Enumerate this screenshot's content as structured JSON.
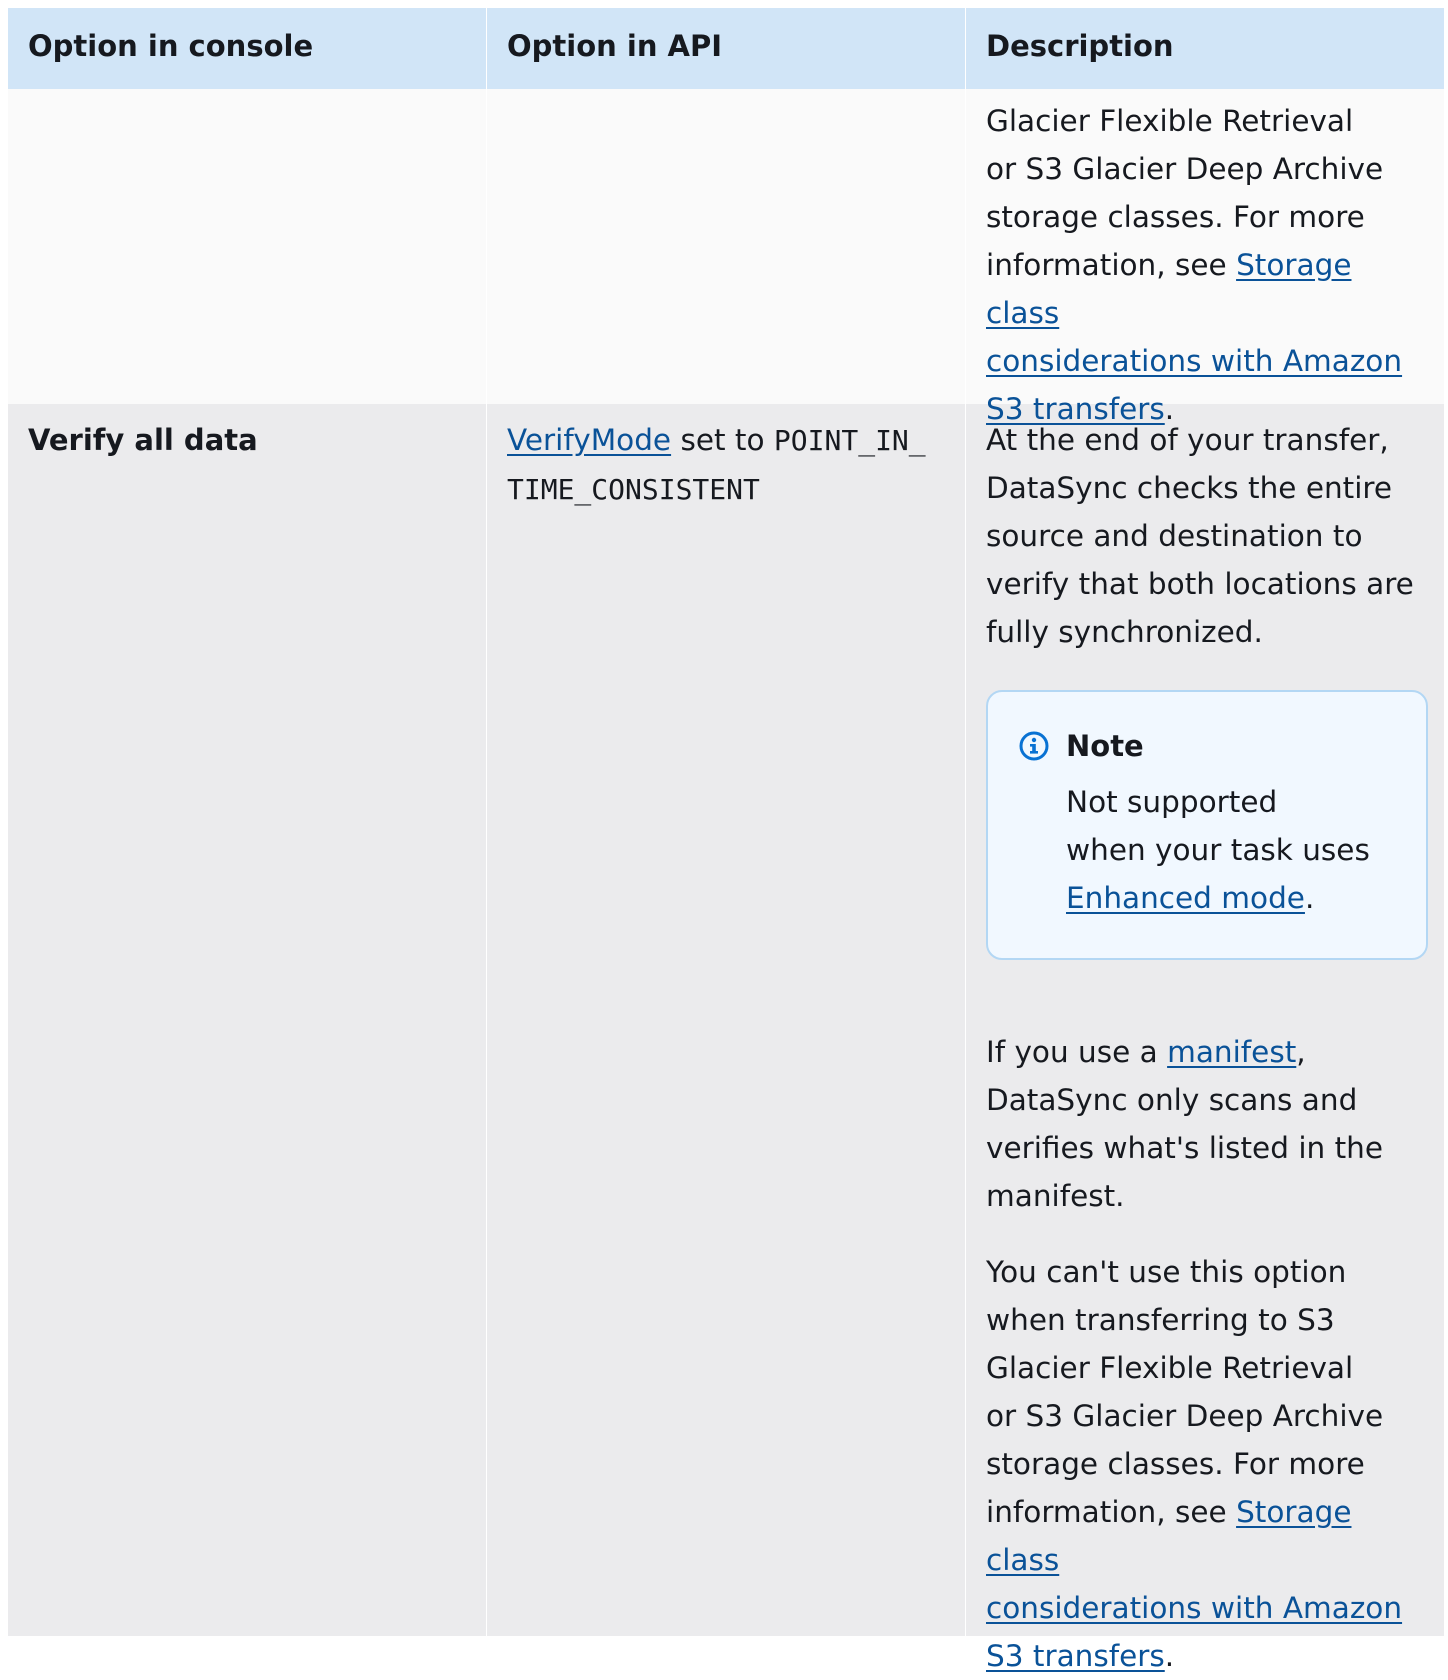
{
  "header": {
    "col1": "Option in console",
    "col2": "Option in API",
    "col3": "Description"
  },
  "row_continued": {
    "desc_lines": [
      "Glacier Flexible Retrieval",
      "or S3 Glacier Deep Archive",
      "storage classes. For more"
    ],
    "desc_prefix": "information, see ",
    "link_lines": [
      "Storage class",
      "considerations with Amazon",
      "S3 transfers"
    ],
    "desc_suffix": "."
  },
  "row_verify": {
    "console_option": "Verify all data",
    "api_link": "VerifyMode",
    "api_text": " set to ",
    "api_code_line1": "POINT_IN_",
    "api_code_line2": "TIME_CONSISTENT",
    "desc_lines": [
      "At the end of your transfer,",
      "DataSync checks the entire",
      "source and destination to",
      "verify that both locations are",
      "fully synchronized."
    ],
    "note": {
      "icon": "info-circle-icon",
      "title": "Note",
      "lines": [
        "Not supported",
        "when your task uses"
      ],
      "link": "Enhanced mode",
      "suffix": "."
    },
    "manifest_prefix": "If you use a ",
    "manifest_link": "manifest",
    "manifest_suffix": ",",
    "manifest_lines": [
      "DataSync only scans and",
      "verifies what's listed in the",
      "manifest."
    ],
    "restriction_lines": [
      "You can't use this option",
      "when transferring to S3",
      "Glacier Flexible Retrieval",
      "or S3 Glacier Deep Archive",
      "storage classes. For more"
    ],
    "restriction_prefix": "information, see ",
    "restriction_link_lines": [
      "Storage class",
      "considerations with Amazon",
      "S3 transfers"
    ],
    "restriction_suffix": "."
  },
  "colors": {
    "header_bg": "#d1e5f7",
    "row_alt_bg": "#ebebed",
    "row_bg": "#fafafa",
    "link": "#0a5298",
    "note_bg": "#f1f8ff",
    "note_border": "#b3d7f4",
    "info_icon": "#0972d3"
  }
}
